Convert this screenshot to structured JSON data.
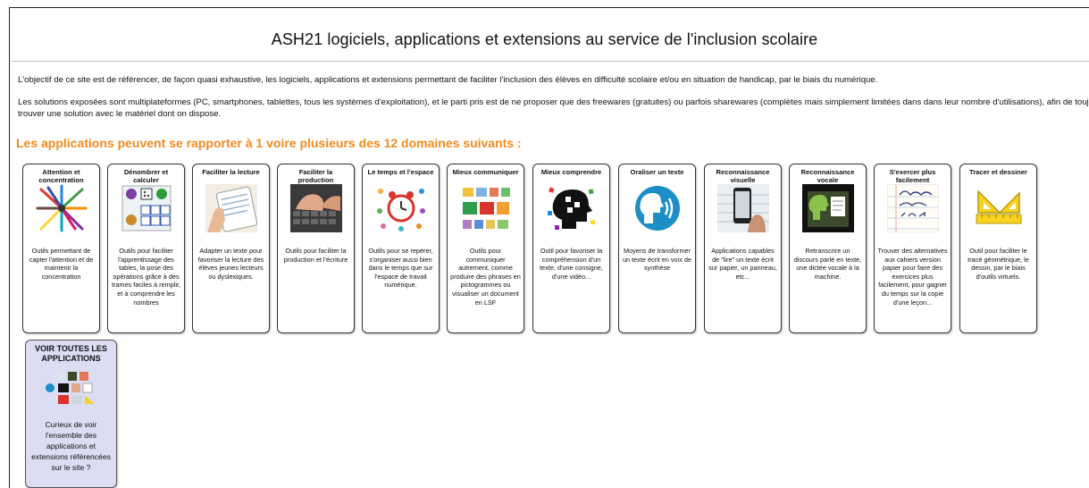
{
  "page": {
    "title": "ASH21 logiciels, applications et extensions au service de l'inclusion scolaire",
    "intro_1": "L'objectif de ce site est de référencer, de façon quasi exhaustive, les logiciels, applications et extensions permettant de faciliter l'inclusion des élèves en difficulté scolaire et/ou en situation de handicap, par le biais du numérique.",
    "intro_2_line1": "Les solutions exposées sont multiplateformes (PC, smartphones, tablettes, tous les systèmes d'exploitation), et le parti pris est de ne proposer que des freewares (gratuites) ou parfois sharewares (complètes mais simplement limitées dans dans leur nombre d'utilisations), afin de toujours pouvoir",
    "intro_2_line2": "trouver une solution avec le matériel dont on dispose.",
    "domains_heading": "Les applications peuvent se rapporter à 1 voire plusieurs des 12 domaines suivants :"
  },
  "cards": [
    {
      "title": "Attention et concentration",
      "desc": "Outils permettant de capter l'attention et de maintenir la concentration",
      "icon": "arrows-target-icon"
    },
    {
      "title": "Dénombrer et calculer",
      "desc": "Outils pour faciliter l'apprentissage des tables, la pose des opérations grâce à des trames faciles à remplir, et à comprendre les nombres",
      "icon": "number-grid-icon"
    },
    {
      "title": "Faciliter la lecture",
      "desc": "Adapter un texte pour favoriser la lecture des élèves jeunes lecteurs ou dyslexiques.",
      "icon": "tablet-reading-icon"
    },
    {
      "title": "Faciliter la production",
      "desc": "Outils pour faciliter la production et l'écriture",
      "icon": "keyboard-typing-icon"
    },
    {
      "title": "Le temps et l'espace",
      "desc": "Outils pour se repérer, s'organiser aussi bien dans le temps que sur l'espace de travail numérique.",
      "icon": "alarm-clock-icon"
    },
    {
      "title": "Mieux communiquer",
      "desc": "Outils pour communiquer autrement, comme produire des phrases en pictogrammes ou visualiser un document en LSF",
      "icon": "pictograms-icon"
    },
    {
      "title": "Mieux comprendre",
      "desc": "Outil pour favoriser la compréhension d'un texte, d'une consigne, d'une vidéo...",
      "icon": "puzzle-head-icon"
    },
    {
      "title": "Oraliser un texte",
      "desc": "Moyens de transformer un texte écrit en voix de synthèse",
      "icon": "speaking-head-icon"
    },
    {
      "title": "Reconnaissance visuelle",
      "desc": "Applications capables de \"lire\" un texte écrit sur papier, un panneau, etc...",
      "icon": "phone-scan-icon"
    },
    {
      "title": "Reconnaissance vocale",
      "desc": "Retranscrire un discours parlé en texte, une dictée vocale à la machine.",
      "icon": "voice-document-icon"
    },
    {
      "title": "S'exercer plus facilement",
      "desc": "Trouver des alternatives aux cahiers version papier pour faire des exercices plus facilement, pour gagner du temps sur la copie d'une leçon...",
      "icon": "handwriting-notebook-icon"
    },
    {
      "title": "Tracer et dessiner",
      "desc": "Outil pour faciliter le tracé géométrique, le dessin, par le biais d'outils virtuels.",
      "icon": "ruler-square-icon"
    }
  ],
  "all_card": {
    "title": "VOIR TOUTES LES APPLICATIONS",
    "desc": "Curieux de voir l'ensemble des applications et extensions référencées sur le site ?",
    "icon": "collage-icon"
  },
  "colors": {
    "accent_orange": "#f28a1f",
    "all_card_bg": "#dcdcf2"
  }
}
